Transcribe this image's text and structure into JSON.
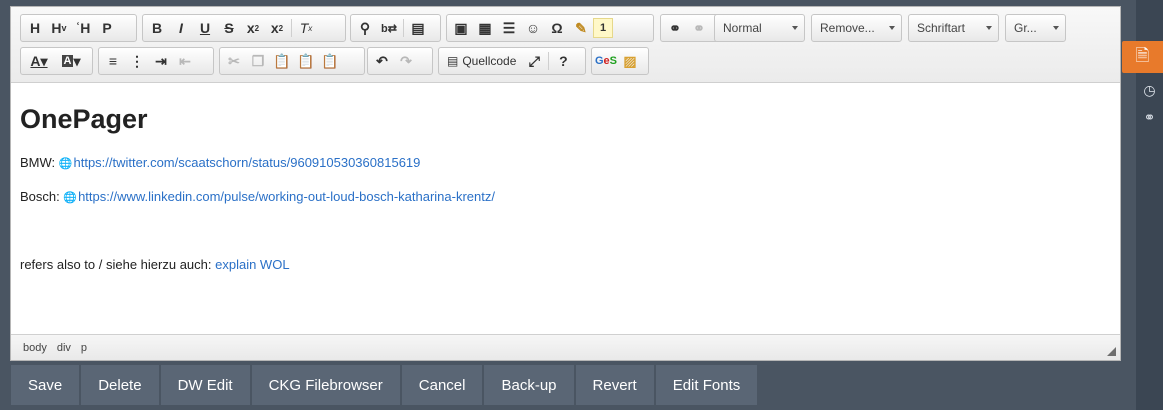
{
  "toolbar": {
    "combos": {
      "format": "Normal",
      "styles": "Remove...",
      "font": "Schriftart",
      "size": "Gr..."
    },
    "source_label": "Quellcode"
  },
  "content": {
    "heading": "OnePager",
    "line1_label": "BMW:",
    "line1_link": "https://twitter.com/scaatschorn/status/960910530360815619",
    "line2_label": "Bosch:",
    "line2_link": "https://www.linkedin.com/pulse/working-out-loud-bosch-katharina-krentz/",
    "line3_prefix": "refers also to / siehe hierzu auch:",
    "line3_link": "explain WOL"
  },
  "statusbar": {
    "path": [
      "body",
      "div",
      "p"
    ]
  },
  "actions": {
    "save": "Save",
    "delete": "Delete",
    "dw_edit": "DW Edit",
    "ckg_filebrowser": "CKG Filebrowser",
    "cancel": "Cancel",
    "backup": "Back-up",
    "revert": "Revert",
    "edit_fonts": "Edit Fonts"
  },
  "icons": [
    "document-icon",
    "clock-icon",
    "link-icon"
  ],
  "colors": {
    "accent": "#e87a2b",
    "link": "#2a70c7",
    "internal_link": "#2d8a2d",
    "button_bg": "#5a6675"
  }
}
